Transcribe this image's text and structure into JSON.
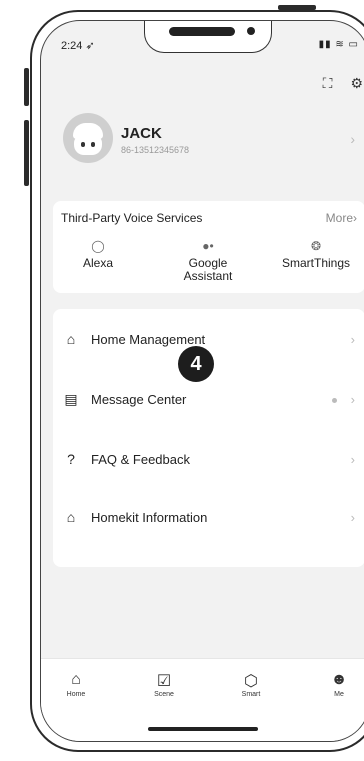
{
  "status_bar": {
    "time": "2:24",
    "icons": "▮▮ ≋ ▭"
  },
  "profile": {
    "name": "JACK",
    "phone": "86-13512345678"
  },
  "voice_services": {
    "title": "Third-Party Voice Services",
    "more": "More",
    "items": [
      {
        "label": "Alexa",
        "icon": "alexa-icon"
      },
      {
        "label": "Google Assistant",
        "icon": "google-assistant-icon"
      },
      {
        "label": "SmartThings",
        "icon": "smartthings-icon"
      }
    ]
  },
  "menu": [
    {
      "label": "Home Management",
      "icon": "house-icon"
    },
    {
      "label": "Message Center",
      "icon": "message-icon"
    },
    {
      "label": "FAQ & Feedback",
      "icon": "question-icon"
    },
    {
      "label": "Homekit Information",
      "icon": "homekit-icon"
    }
  ],
  "step_badge": "4",
  "tabs": [
    {
      "label": "Home"
    },
    {
      "label": "Scene"
    },
    {
      "label": "Smart"
    },
    {
      "label": "Me"
    }
  ]
}
